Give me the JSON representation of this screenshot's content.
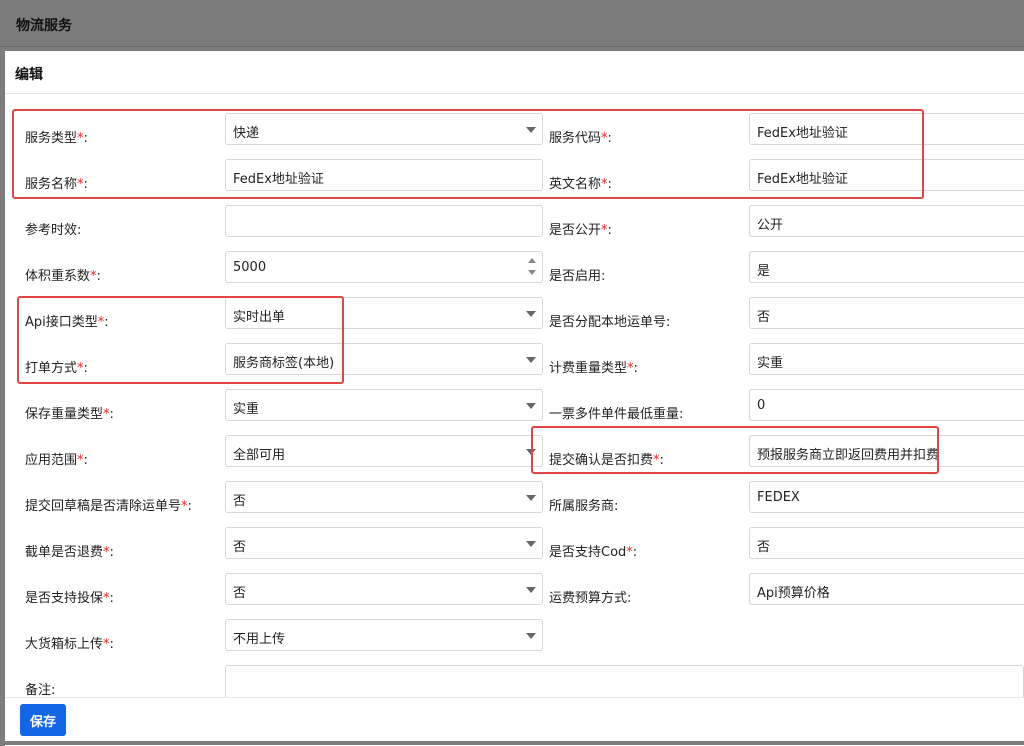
{
  "app": {
    "title": "物流服务"
  },
  "modal": {
    "title": "编辑",
    "save_label": "保存"
  },
  "colors": {
    "accent": "#1367e6",
    "required": "#e22222",
    "highlight": "#e04646"
  },
  "form": {
    "service_type": {
      "label": "服务类型",
      "value": "快递",
      "required": "*"
    },
    "service_code": {
      "label": "服务代码",
      "value": "FedEx地址验证",
      "required": "*"
    },
    "service_name": {
      "label": "服务名称",
      "value": "FedEx地址验证",
      "required": "*"
    },
    "english_name": {
      "label": "英文名称",
      "value": "FedEx地址验证",
      "required": "*"
    },
    "ref_time": {
      "label": "参考时效:",
      "value": ""
    },
    "is_public": {
      "label": "是否公开",
      "value": "公开",
      "required": "*"
    },
    "vol_factor": {
      "label": "体积重系数",
      "value": "5000",
      "required": "*"
    },
    "is_enabled": {
      "label": "是否启用:",
      "value": "是"
    },
    "api_type": {
      "label": "Api接口类型",
      "value": "实时出单",
      "required": "*"
    },
    "alloc_local": {
      "label": "是否分配本地运单号:",
      "value": "否"
    },
    "print_mode": {
      "label": "打单方式",
      "value": "服务商标签(本地)",
      "required": "*"
    },
    "billing_weight_type": {
      "label": "计费重量类型",
      "value": "实重",
      "required": "*"
    },
    "save_weight_type": {
      "label": "保存重量类型",
      "value": "实重",
      "required": "*"
    },
    "min_weight": {
      "label": "一票多件单件最低重量:",
      "value": "0"
    },
    "scope": {
      "label": "应用范围",
      "value": "全部可用",
      "required": "*"
    },
    "deduct_on_submit": {
      "label": "提交确认是否扣费",
      "value": "预报服务商立即返回费用并扣费",
      "required": "*"
    },
    "clear_tracking": {
      "label": "提交回草稿是否清除运单号",
      "value": "否",
      "required": "*"
    },
    "provider": {
      "label": "所属服务商:",
      "value": "FEDEX"
    },
    "refund_on_cutoff": {
      "label": "截单是否退费",
      "value": "否",
      "required": "*"
    },
    "support_cod": {
      "label": "是否支持Cod",
      "value": "否",
      "required": "*"
    },
    "support_insurance": {
      "label": "是否支持投保",
      "value": "否",
      "required": "*"
    },
    "freight_budget": {
      "label": "运费预算方式:",
      "value": "Api预算价格"
    },
    "bulk_label_upload": {
      "label": "大货箱标上传",
      "value": "不用上传",
      "required": "*"
    },
    "remark": {
      "label": "备注:",
      "value": ""
    }
  }
}
